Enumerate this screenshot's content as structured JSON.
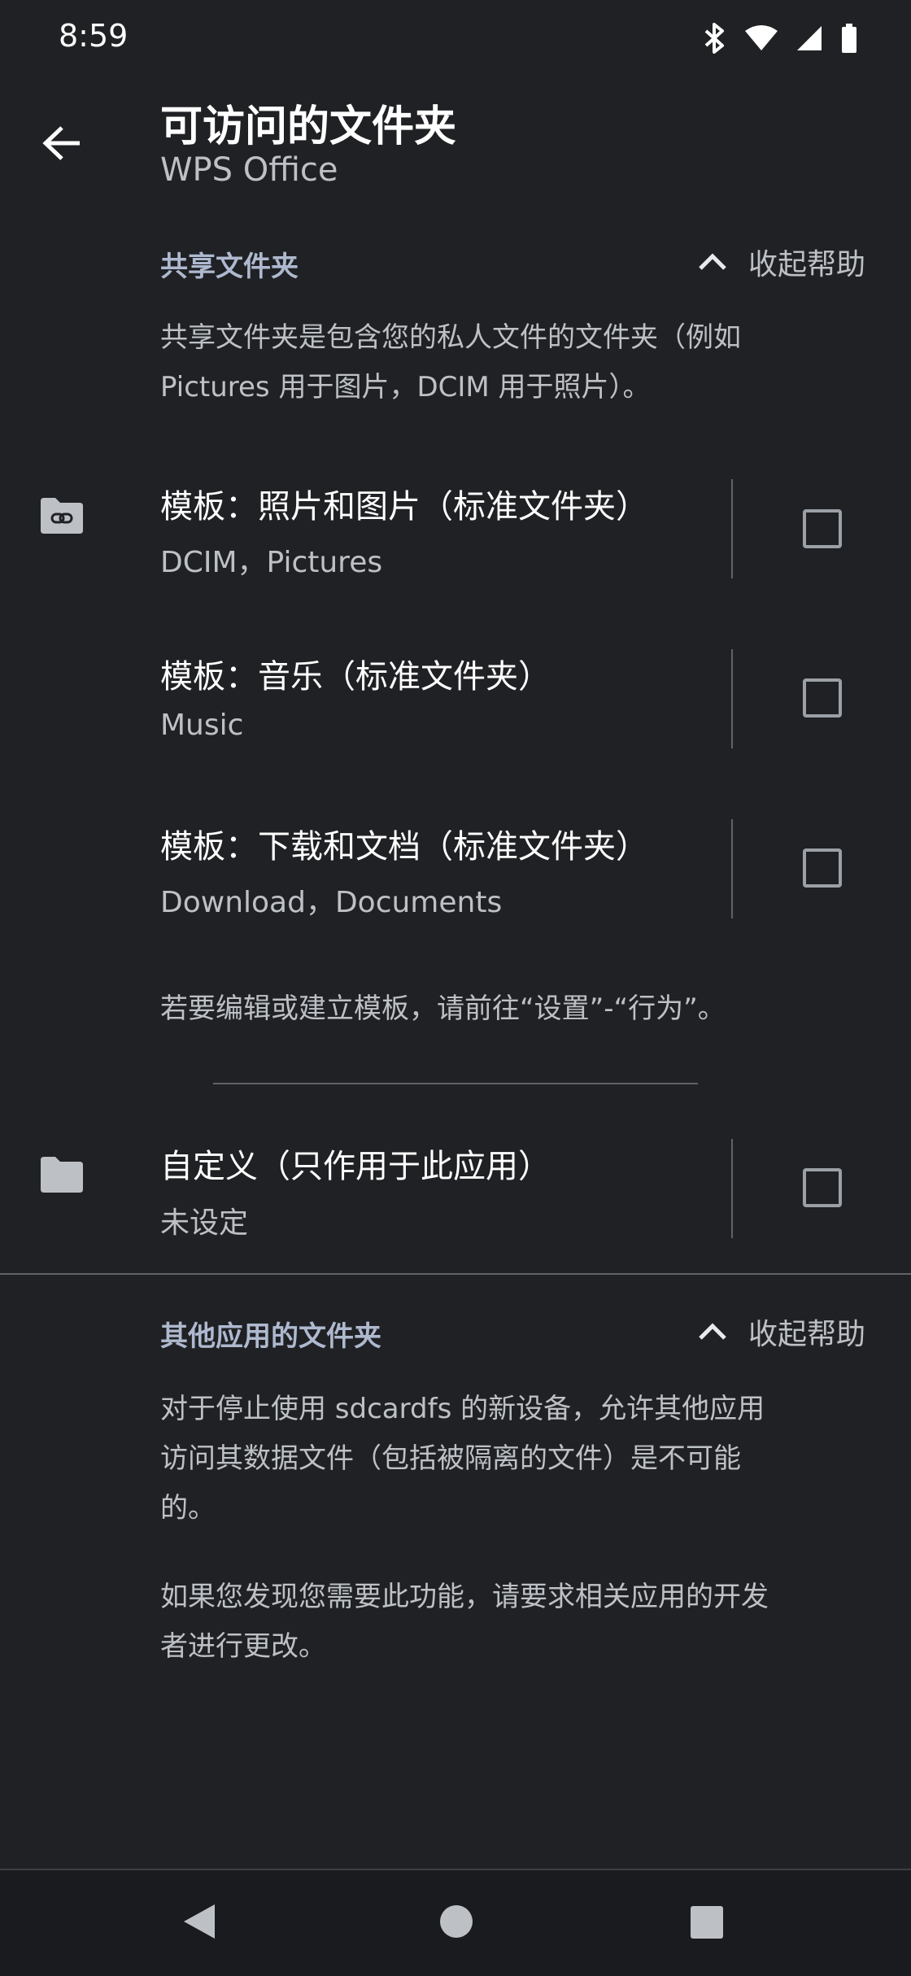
{
  "status_bar": {
    "time": "8:59",
    "icons": [
      "bluetooth-icon",
      "wifi-icon",
      "cellular-signal-icon",
      "battery-icon"
    ]
  },
  "header": {
    "title": "可访问的文件夹",
    "subtitle": "WPS Office",
    "back_icon": "back-arrow-icon"
  },
  "shared_section": {
    "title": "共享文件夹",
    "collapse_label": "收起帮助",
    "help_lines": [
      "共享文件夹是包含您的私人文件的文件夹（例如",
      "Pictures 用于图片，DCIM 用于照片）。"
    ],
    "items": [
      {
        "title": "模板：照片和图片（标准文件夹）",
        "subtitle": "DCIM，Pictures",
        "checked": false
      },
      {
        "title": "模板：音乐（标准文件夹）",
        "subtitle": "Music",
        "checked": false
      },
      {
        "title": "模板：下载和文档（标准文件夹）",
        "subtitle": "Download，Documents",
        "checked": false
      }
    ],
    "template_note": "若要编辑或建立模板，请前往“设置”-“行为”。"
  },
  "custom_item": {
    "title": "自定义（只作用于此应用）",
    "subtitle": "未设定",
    "checked": false
  },
  "other_section": {
    "title": "其他应用的文件夹",
    "collapse_label": "收起帮助",
    "help_lines": [
      "对于停止使用 sdcardfs 的新设备，允许其他应用",
      "访问其数据文件（包括被隔离的文件）是不可能",
      "的。"
    ],
    "help_lines_2": [
      "如果您发现您需要此功能，请要求相关应用的开发",
      "者进行更改。"
    ]
  },
  "nav_bar": {
    "back": "nav-back-icon",
    "home": "nav-home-icon",
    "recents": "nav-recents-icon"
  },
  "colors": {
    "background": "#202124",
    "text_primary": "#ffffff",
    "text_secondary": "#bdc1c6",
    "section_title": "#aeb9cf",
    "divider": "#5f6368"
  }
}
